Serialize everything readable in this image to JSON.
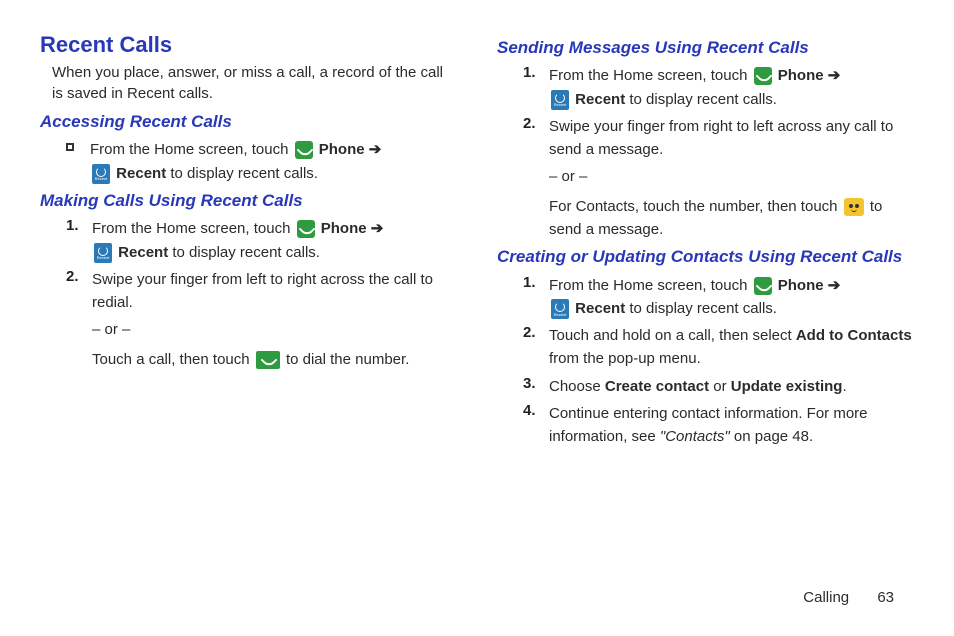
{
  "header": {
    "title": "Recent Calls",
    "intro": "When you place, answer, or miss a call, a record of the call is saved in Recent calls."
  },
  "sections": {
    "accessing": {
      "title": "Accessing Recent Calls",
      "bullet_pre": "From the Home screen, touch ",
      "phone_label": "Phone",
      "arrow": "➔",
      "recent_label": "Recent",
      "bullet_post": " to display recent calls."
    },
    "making": {
      "title": "Making Calls Using Recent Calls",
      "item1_pre": "From the Home screen, touch ",
      "item1_phone": "Phone",
      "item1_arrow": "➔",
      "item1_recent": "Recent",
      "item1_post": " to display recent calls.",
      "item2": "Swipe your finger from left to right across the call to redial.",
      "or": "– or –",
      "touch_pre": "Touch a call, then touch ",
      "touch_post": " to dial the number."
    },
    "sending": {
      "title": "Sending Messages Using Recent Calls",
      "item1_pre": "From the Home screen, touch ",
      "item1_phone": "Phone",
      "item1_arrow": "➔",
      "item1_recent": "Recent",
      "item1_post": " to display recent calls.",
      "item2": "Swipe your finger from right to left across any call to send a message.",
      "or": "– or –",
      "contacts_pre": "For Contacts, touch the number, then touch ",
      "contacts_post": " to send a message."
    },
    "creating": {
      "title": "Creating or Updating Contacts Using Recent Calls",
      "item1_pre": "From the Home screen, touch ",
      "item1_phone": "Phone",
      "item1_arrow": "➔",
      "item1_recent": "Recent",
      "item1_post": " to display recent calls.",
      "item2_pre": "Touch and hold on a call, then select ",
      "item2_bold": "Add to Contacts",
      "item2_post": " from the pop-up menu.",
      "item3_pre": "Choose ",
      "item3_b1": "Create contact",
      "item3_mid": " or ",
      "item3_b2": "Update existing",
      "item3_post": ".",
      "item4_pre": "Continue entering contact information. For more information, see ",
      "item4_ref": "\"Contacts\"",
      "item4_post": " on page 48."
    }
  },
  "numbers": {
    "n1": "1.",
    "n2": "2.",
    "n3": "3.",
    "n4": "4."
  },
  "footer": {
    "section": "Calling",
    "page": "63"
  }
}
